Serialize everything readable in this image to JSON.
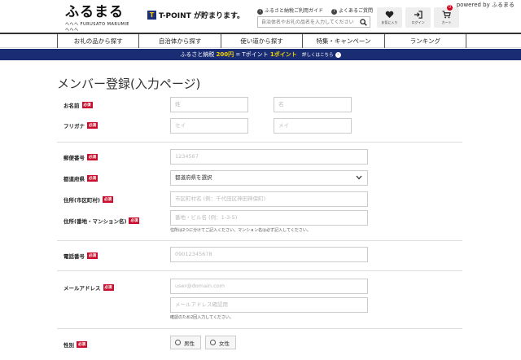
{
  "header": {
    "powered_by": "powered by ふるまる",
    "logo_main": "ふるまる",
    "logo_sub": "ヘヘヘ FURUSATO MARUMIE ヘヘヘ",
    "tpoint_badge": "T",
    "tpoint_text": "T-POINT が貯まります。",
    "guide_link": "ふるさと納税ご利用ガイド",
    "faq_link": "よくあるご質問",
    "search_placeholder": "自治体名やお礼の品名を入力してください",
    "icons": [
      {
        "name": "heart-icon",
        "label": "お気に入り"
      },
      {
        "name": "login-icon",
        "label": "ログイン"
      },
      {
        "name": "cart-icon",
        "label": "カート",
        "badge": "0"
      }
    ]
  },
  "nav": {
    "items": [
      "お礼の品から探す",
      "自治体から探す",
      "使い道から探す",
      "特集・キャンペーン",
      "ランキング"
    ]
  },
  "banner": {
    "pre": "ふるさと納税",
    "amount": "200円",
    "mid": " = Tポイント ",
    "points": "1ポイント",
    "detail": "詳しくはこちら",
    "arrow": "›"
  },
  "form": {
    "title": "メンバー登録(入力ページ)",
    "required": "必須",
    "name_label": "お名前",
    "last_name_placeholder": "姓",
    "first_name_placeholder": "名",
    "kana_label": "フリガナ",
    "last_kana_placeholder": "セイ",
    "first_kana_placeholder": "メイ",
    "zip_label": "郵便番号",
    "zip_placeholder": "1234567",
    "pref_label": "都道府県",
    "pref_value": "都道府県を選択",
    "city_label": "住所(市区町村)",
    "city_placeholder": "市区町村名 (例：千代田区神田神保町)",
    "addr_label": "住所(番地・マンション名)",
    "addr_placeholder": "番地・ビル名 (例：1-3-5)",
    "addr_note": "住所は2つに分けてご記入ください。マンション名は必ず記入してください。",
    "phone_label": "電話番号",
    "phone_placeholder": "09012345678",
    "email_label": "メールアドレス",
    "email_placeholder": "user@domain.com",
    "email_confirm_placeholder": "メールアドレス確認用",
    "email_note": "確認のため2回入力してください。",
    "gender_label": "性別",
    "gender_male": "男性",
    "gender_female": "女性"
  }
}
